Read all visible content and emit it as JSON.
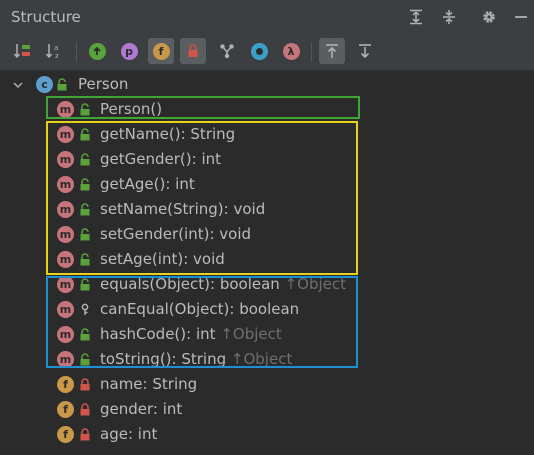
{
  "panel": {
    "title": "Structure"
  },
  "tree": {
    "root": {
      "name": "Person",
      "icon": "class-icon"
    },
    "members": [
      {
        "name": "Person()",
        "type": "",
        "inherited": "",
        "kind": "method",
        "visibility": "public"
      },
      {
        "name": "getName()",
        "type": ": String",
        "inherited": "",
        "kind": "method",
        "visibility": "public"
      },
      {
        "name": "getGender()",
        "type": ": int",
        "inherited": "",
        "kind": "method",
        "visibility": "public"
      },
      {
        "name": "getAge()",
        "type": ": int",
        "inherited": "",
        "kind": "method",
        "visibility": "public"
      },
      {
        "name": "setName(String)",
        "type": ": void",
        "inherited": "",
        "kind": "method",
        "visibility": "public"
      },
      {
        "name": "setGender(int)",
        "type": ": void",
        "inherited": "",
        "kind": "method",
        "visibility": "public"
      },
      {
        "name": "setAge(int)",
        "type": ": void",
        "inherited": "",
        "kind": "method",
        "visibility": "public"
      },
      {
        "name": "equals(Object)",
        "type": ": boolean",
        "inherited": "↑Object",
        "kind": "method",
        "visibility": "public"
      },
      {
        "name": "canEqual(Object)",
        "type": ": boolean",
        "inherited": "",
        "kind": "method",
        "visibility": "protected"
      },
      {
        "name": "hashCode()",
        "type": ": int",
        "inherited": "↑Object",
        "kind": "method",
        "visibility": "public"
      },
      {
        "name": "toString()",
        "type": ": String",
        "inherited": "↑Object",
        "kind": "method",
        "visibility": "public"
      },
      {
        "name": "name",
        "type": ": String",
        "inherited": "",
        "kind": "field",
        "visibility": "private"
      },
      {
        "name": "gender",
        "type": ": int",
        "inherited": "",
        "kind": "field",
        "visibility": "private"
      },
      {
        "name": "age",
        "type": ": int",
        "inherited": "",
        "kind": "field",
        "visibility": "private"
      }
    ]
  },
  "highlight_colors": {
    "constructor_box": "#3fa535",
    "accessors_box": "#e6d21a",
    "object_methods_box": "#1e8fd0"
  },
  "icon_letters": {
    "method": "m",
    "field": "f",
    "class": "c",
    "property": "p",
    "lambda": "λ"
  },
  "colors": {
    "method_badge": "#c7747b",
    "field_badge": "#c99848",
    "class_badge": "#5e9fd0",
    "public_lock": "#5aa33c",
    "private_lock": "#d2544b",
    "inherited_text": "#6f6f6f"
  }
}
